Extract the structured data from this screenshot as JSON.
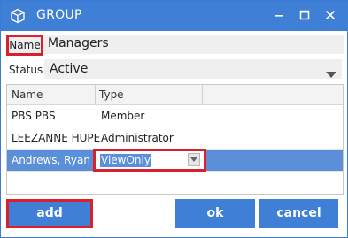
{
  "window": {
    "title": "GROUP",
    "icon": "cube-icon",
    "controls": [
      "minimize-icon",
      "maximize-icon",
      "close-icon"
    ],
    "colors": {
      "accent": "#3f7fd6",
      "highlight": "#d9202c",
      "selected_row": "#5b8fd9"
    }
  },
  "form": {
    "name_label": "Name",
    "name_value": "Managers",
    "status_label": "Status",
    "status_value": "Active"
  },
  "grid": {
    "headers": {
      "name": "Name",
      "type": "Type"
    },
    "rows": [
      {
        "name": "PBS PBS",
        "type": "Member"
      },
      {
        "name": "LEEZANNE HUPE",
        "type": "Administrator"
      },
      {
        "name": "Andrews, Ryan",
        "type": "ViewOnly"
      }
    ],
    "selected_index": 2
  },
  "buttons": {
    "add": "add",
    "ok": "ok",
    "cancel": "cancel"
  }
}
